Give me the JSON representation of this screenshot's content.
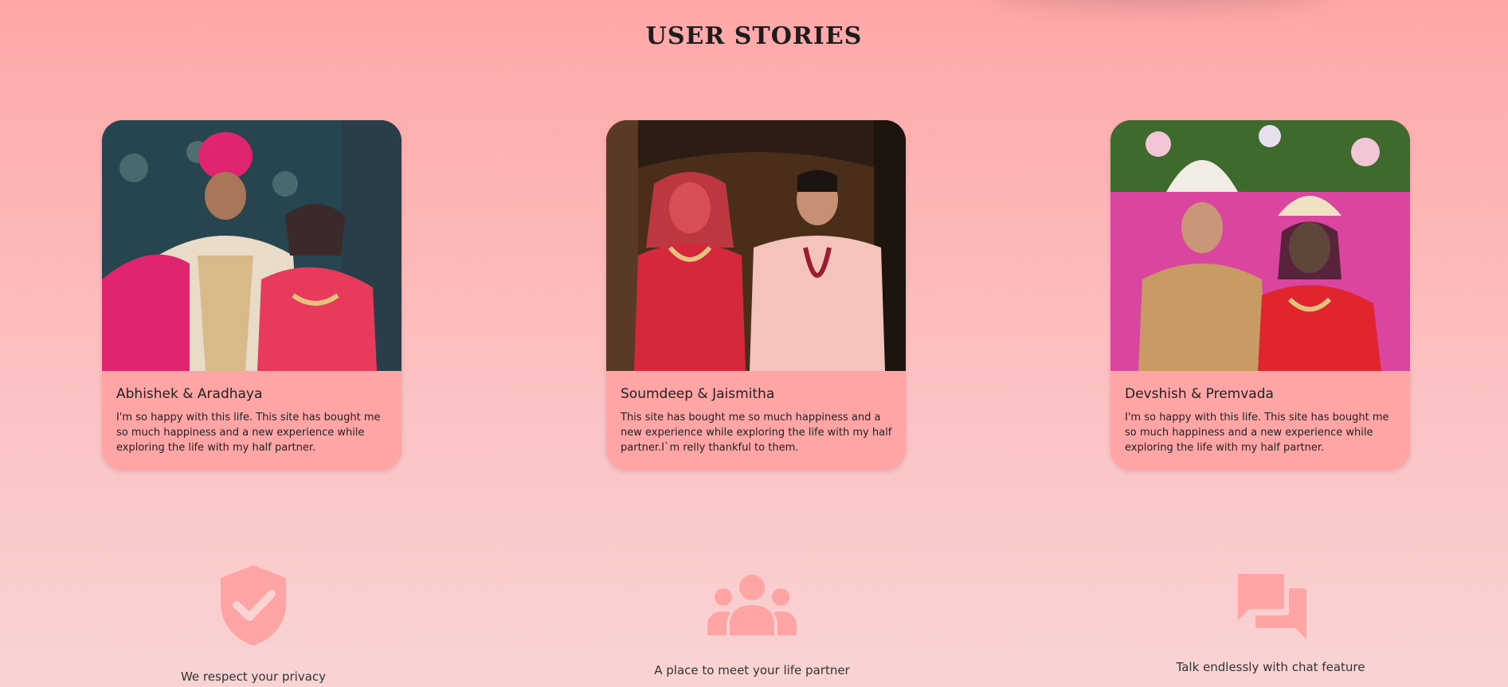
{
  "section_title": "USER STORIES",
  "stories": [
    {
      "name": "Abhishek & Aradhaya",
      "text": "I'm so happy with this life. This site has bought me so much happiness and a new experience while exploring the life with my half partner."
    },
    {
      "name": "Soumdeep & Jaismitha",
      "text": "This site has bought me so much happiness and a new experience while exploring the life with my half partner.I`m relly thankful to them."
    },
    {
      "name": "Devshish & Premvada",
      "text": "I'm so happy with this life. This site has bought me so much happiness and a new experience while exploring the life with my half partner."
    }
  ],
  "features": [
    {
      "icon": "shield-check-icon",
      "label": "We respect your privacy"
    },
    {
      "icon": "people-group-icon",
      "label": "A place to meet your life partner"
    },
    {
      "icon": "chat-bubbles-icon",
      "label": "Talk endlessly with chat feature"
    }
  ],
  "colors": {
    "accent": "#ffa5a6",
    "icon": "#ffa4a5",
    "background_top": "#ffa7a8",
    "background_bottom": "#f9d3d3"
  }
}
